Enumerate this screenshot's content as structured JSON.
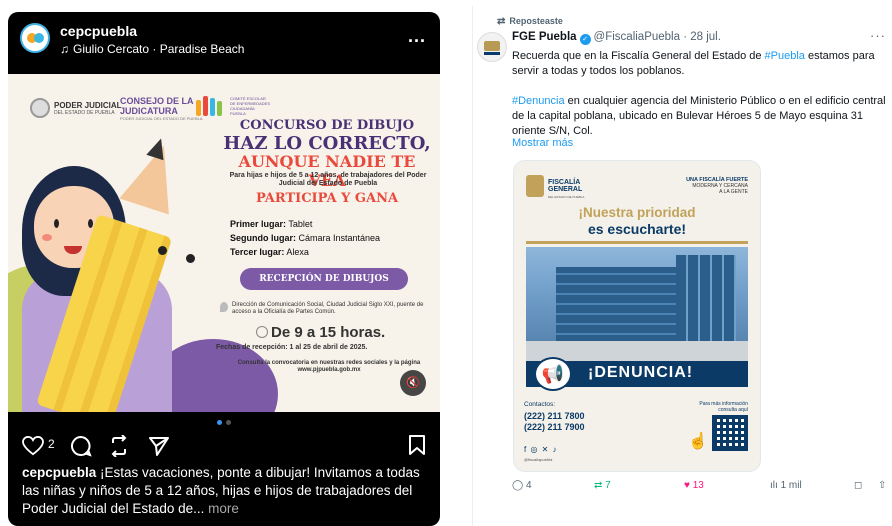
{
  "instagram": {
    "username": "cepcpuebla",
    "music": "Giulio Cercato · Paradise Beach",
    "more": "...",
    "poster": {
      "logo_pj_line1": "PODER JUDICIAL",
      "logo_pj_line2": "DEL ESTADO DE PUEBLA",
      "logo_cj_line1": "CONSEJO DE LA",
      "logo_cj_line2": "JUDICATURA",
      "logo_cj_line3": "PODER JUDICIAL DEL ESTADO DE PUEBLA",
      "logo_comite": "COMITÉ ESCOLAR DE ENFERMEDADES CIUDADANÍA PUEBLA",
      "title": "CONCURSO DE DIBUJO",
      "headline1": "HAZ LO CORRECTO,",
      "headline2": "AUNQUE NADIE TE VEA",
      "for_whom": "Para hijas e hijos de 5 a 12 años, de trabajadores del Poder Judicial del Estado de Puebla",
      "participa": "PARTICIPA Y GANA",
      "prizes": [
        {
          "label": "Primer lugar:",
          "value": "Tablet"
        },
        {
          "label": "Segundo lugar:",
          "value": "Cámara Instantánea"
        },
        {
          "label": "Tercer lugar:",
          "value": "Alexa"
        }
      ],
      "button": "RECEPCIÓN DE DIBUJOS",
      "address": "Dirección de Comunicación Social, Ciudad Judicial Siglo XXI, puente de acceso a la Oficialía de Partes Común.",
      "hours": "De 9 a 15 horas.",
      "dates": "Fechas de recepción: 1 al 25 de abril de 2025.",
      "consulta": "Consulta la convocatoria en nuestras redes sociales y la página www.pjpuebla.gob.mx",
      "mute_icon": "🔇"
    },
    "carousel": {
      "total": 2,
      "active": 1
    },
    "likes": "2",
    "caption_user": "cepcpuebla",
    "caption_text": " ¡Estas vacaciones, ponte a dibujar! Invitamos a todas las niñas y niños de 5 a 12 años, hijas e hijos de trabajadores del Poder Judicial del Estado de...",
    "caption_more": " more",
    "icons": {
      "like": "heart-icon",
      "comment": "comment-icon",
      "repost": "repost-icon",
      "share": "send-icon",
      "save": "bookmark-icon"
    }
  },
  "tweet": {
    "repost_label": "Reposteaste",
    "name": "FGE Puebla",
    "handle": "@FiscaliaPuebla",
    "sep": " · ",
    "date": "28 jul.",
    "more": "···",
    "text1_a": "Recuerda que en la Fiscalía General del Estado de ",
    "text1_hash": "#Puebla",
    "text1_b": " estamos para servir a todas y todos los poblanos.",
    "text2_hash": "#Denuncia",
    "text2_b": " en cualquier agencia del Ministerio Público o en el edificio central de la capital poblana, ubicado en Bulevar Héroes 5 de Mayo esquina 31 oriente S/N, Col.",
    "show_more": "Mostrar más",
    "image": {
      "logo_line1": "FISCALÍA",
      "logo_line2": "GENERAL",
      "logo_sub": "DEL ESTADO DE PUEBLA",
      "slogan_b": "UNA FISCALÍA FUERTE",
      "slogan_1": "MODERNA Y CERCANA",
      "slogan_2": "A LA GENTE",
      "h1": "¡Nuestra prioridad",
      "h2": "es escucharte!",
      "denuncia": "¡DENUNCIA!",
      "contact_label": "Contactos:",
      "phone1": "(222) 211 7800",
      "phone2": "(222) 211 7900",
      "social": "f ◎ ✕ ♪",
      "social_handle": "@fiscaliapuebla",
      "info_1": "Para más información",
      "info_2": "consulta aquí"
    },
    "stats": {
      "replies": "4",
      "reposts": "7",
      "likes": "13",
      "views": "1 mil"
    },
    "colors": {
      "link": "#1d9bf0",
      "repost": "#00ba7c",
      "like": "#f91880"
    }
  }
}
